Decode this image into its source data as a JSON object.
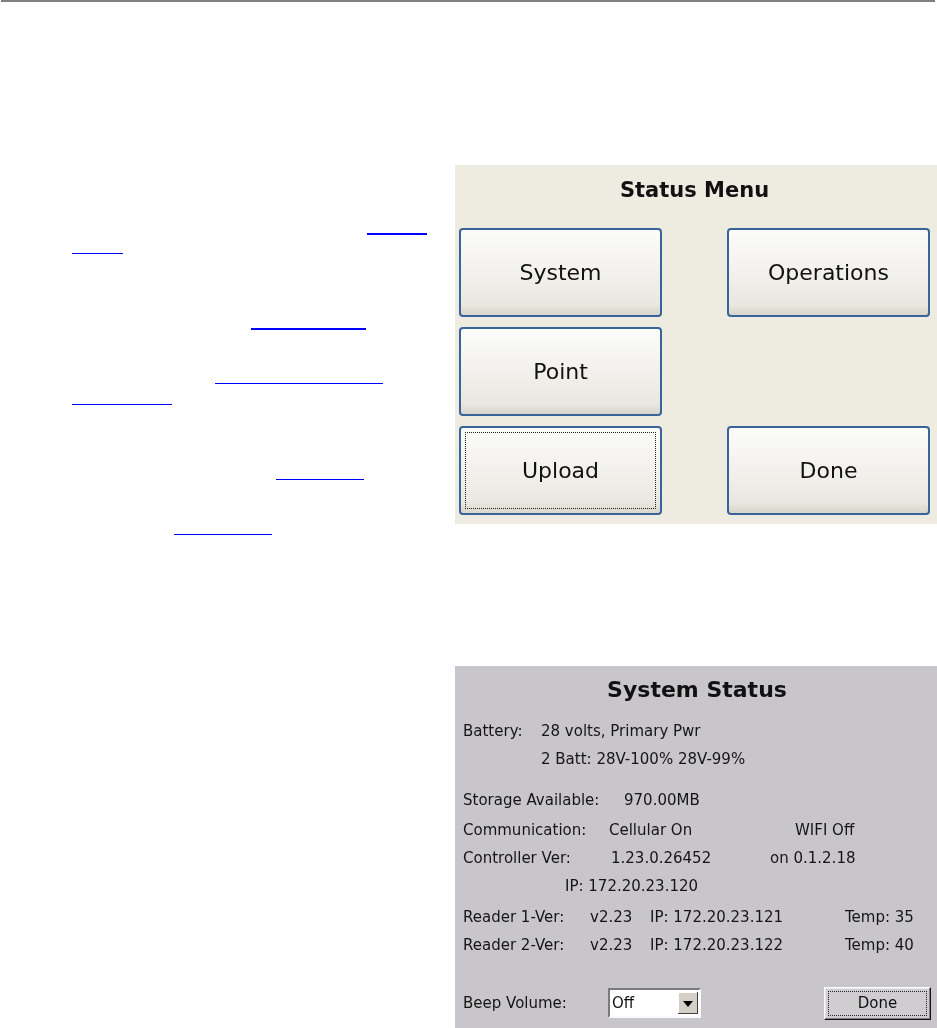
{
  "status_menu": {
    "title": "Status Menu",
    "rows": [
      [
        {
          "label": "System",
          "focused": false
        },
        {
          "label": "Operations",
          "focused": false
        }
      ],
      [
        {
          "label": "Point",
          "focused": false
        }
      ],
      [
        {
          "label": "Upload",
          "focused": true
        },
        {
          "label": "Done",
          "focused": false
        }
      ]
    ]
  },
  "system_status": {
    "title": "System Status",
    "battery": {
      "label": "Battery:",
      "lines": [
        "28 volts, Primary Pwr",
        "2 Batt: 28V-100% 28V-99%"
      ]
    },
    "storage": {
      "label": "Storage Available:",
      "value": "970.00MB"
    },
    "communication": {
      "label": "Communication:",
      "cellular": "Cellular On",
      "wifi": "WIFI Off"
    },
    "controller": {
      "label": "Controller Ver:",
      "version": "1.23.0.26452",
      "note": "on 0.1.2.18",
      "ip": "IP: 172.20.23.120"
    },
    "readers": [
      {
        "label": "Reader 1-Ver:",
        "version": "v2.23",
        "ip": "IP: 172.20.23.121",
        "temp": "Temp: 35"
      },
      {
        "label": "Reader 2-Ver:",
        "version": "v2.23",
        "ip": "IP: 172.20.23.122",
        "temp": "Temp: 40"
      }
    ],
    "beep_volume": {
      "label": "Beep Volume:",
      "value": "Off"
    },
    "done_button": {
      "label": "Done",
      "focused": true
    }
  }
}
